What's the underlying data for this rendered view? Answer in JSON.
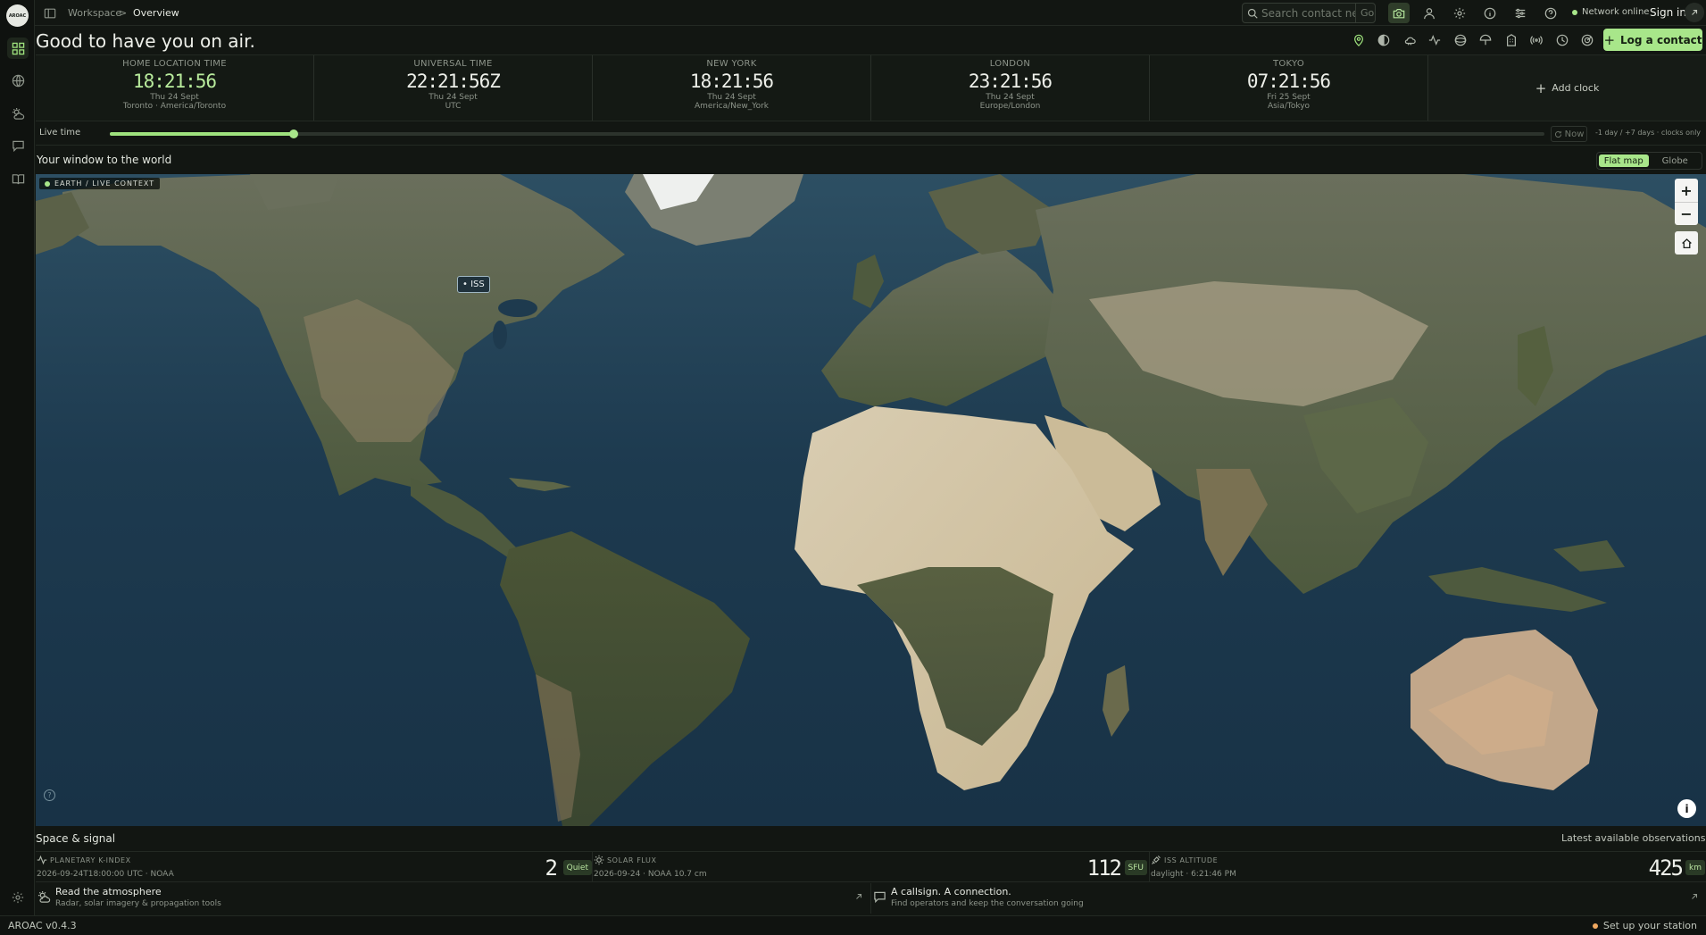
{
  "app": {
    "logo_text": "AROAC",
    "version": "AROAC v0.4.3"
  },
  "breadcrumb": {
    "workspace": "Workspace",
    "separator": ">",
    "current": "Overview"
  },
  "search": {
    "placeholder": "Search contact ne",
    "go_label": "Go"
  },
  "status": {
    "network": "Network online",
    "sign_in": "Sign in"
  },
  "header": {
    "greeting": "Good to have you on air.",
    "log_contact_label": "Log a contact"
  },
  "clocks": [
    {
      "label": "HOME LOCATION TIME",
      "time": "18:21:56",
      "date": "Thu 24 Sept",
      "zone": "Toronto · America/Toronto"
    },
    {
      "label": "UNIVERSAL TIME",
      "time": "22:21:56Z",
      "date": "Thu 24 Sept",
      "zone": "UTC"
    },
    {
      "label": "NEW YORK",
      "time": "18:21:56",
      "date": "Thu 24 Sept",
      "zone": "America/New_York"
    },
    {
      "label": "LONDON",
      "time": "23:21:56",
      "date": "Thu 24 Sept",
      "zone": "Europe/London"
    },
    {
      "label": "TOKYO",
      "time": "07:21:56",
      "date": "Fri 25 Sept",
      "zone": "Asia/Tokyo"
    }
  ],
  "add_clock_label": "Add clock",
  "live_time": {
    "label": "Live time",
    "now_label": "Now",
    "range_note": "-1 day / +7 days · clocks only",
    "slider_position": 0.128
  },
  "map": {
    "title": "Your window to the world",
    "view_flat": "Flat map",
    "view_globe": "Globe",
    "badge": "EARTH / LIVE CONTEXT",
    "iss_label": "• ISS",
    "zoom_in": "+",
    "zoom_out": "−",
    "help": "?",
    "info": "i"
  },
  "space_signal": {
    "title": "Space & signal",
    "latest": "Latest available observations",
    "k_index": {
      "label": "PLANETARY K-INDEX",
      "sub": "2026-09-24T18:00:00 UTC · NOAA",
      "value": "2",
      "tag": "Quiet"
    },
    "solar_flux": {
      "label": "SOLAR FLUX",
      "sub": "2026-09-24 · NOAA 10.7 cm",
      "value": "112",
      "tag": "SFU"
    },
    "iss_altitude": {
      "label": "ISS ALTITUDE",
      "sub": "daylight · 6:21:46 PM",
      "value": "425",
      "tag": "km"
    }
  },
  "cards": [
    {
      "title": "Read the atmosphere",
      "sub": "Radar, solar imagery & propagation tools"
    },
    {
      "title": "A callsign. A connection.",
      "sub": "Find operators and keep the conversation going"
    }
  ],
  "footer": {
    "setup_label": "Set up your station"
  },
  "colors": {
    "accent": "#a8e68a",
    "background": "#121612",
    "ocean": "#1d3a4f"
  }
}
